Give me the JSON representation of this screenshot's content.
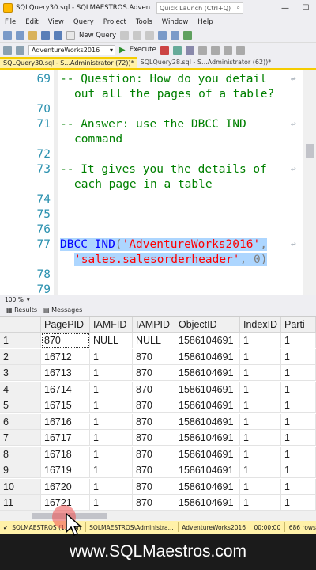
{
  "window": {
    "title": "SQLQuery30.sql - SQLMAESTROS.Adventure...",
    "quick_launch": "Quick Launch (Ctrl+Q)",
    "minimize": "—",
    "maximize": "☐",
    "close": "✕"
  },
  "menu": [
    "File",
    "Edit",
    "View",
    "Query",
    "Project",
    "Tools",
    "Window",
    "Help"
  ],
  "toolbar": {
    "new_query": "New Query",
    "database": "AdventureWorks2016",
    "execute": "Execute"
  },
  "tabs": [
    {
      "label": "SQLQuery30.sql - S...Administrator (72))*",
      "active": true
    },
    {
      "label": "SQLQuery28.sql - S...Administrator (62))*",
      "active": false
    }
  ],
  "editor": {
    "lines": [
      {
        "num": "69",
        "text": "-- Question: How do you detail",
        "type": "comment",
        "ret": true
      },
      {
        "num": "",
        "text": "out all the pages of a table?",
        "type": "comment-cont",
        "ret": false
      },
      {
        "num": "70",
        "text": "",
        "type": "blank",
        "ret": false
      },
      {
        "num": "71",
        "text": "-- Answer: use the DBCC IND",
        "type": "comment",
        "ret": true
      },
      {
        "num": "",
        "text": "command",
        "type": "comment-cont",
        "ret": false
      },
      {
        "num": "72",
        "text": "",
        "type": "blank",
        "ret": false
      },
      {
        "num": "73",
        "text": "-- It gives you the details of",
        "type": "comment",
        "ret": true
      },
      {
        "num": "",
        "text": "each page in a table",
        "type": "comment-cont",
        "ret": false
      },
      {
        "num": "74",
        "text": "",
        "type": "blank",
        "ret": false
      },
      {
        "num": "75",
        "text": "",
        "type": "blank",
        "ret": false
      },
      {
        "num": "76",
        "text": "",
        "type": "blank",
        "ret": false
      },
      {
        "num": "77",
        "text": "",
        "type": "code1",
        "ret": true
      },
      {
        "num": "",
        "text": "",
        "type": "code2",
        "ret": false
      },
      {
        "num": "78",
        "text": "",
        "type": "blank",
        "ret": false
      },
      {
        "num": "79",
        "text": "",
        "type": "blank",
        "ret": false
      }
    ],
    "code77": {
      "kw1": "DBCC",
      "kw2": "IND",
      "p1": "(",
      "s1": "'AdventureWorks2016'",
      "c1": ",",
      "s2": "'sales.salesorderheader'",
      "c2": ",",
      "n": "0",
      "p2": ")"
    }
  },
  "zoom": "100 %",
  "results_tabs": {
    "results": "Results",
    "messages": "Messages"
  },
  "grid": {
    "columns": [
      "",
      "PagePID",
      "IAMFID",
      "IAMPID",
      "ObjectID",
      "IndexID",
      "Parti"
    ],
    "rows": [
      [
        "1",
        "870",
        "NULL",
        "NULL",
        "1586104691",
        "1",
        "1"
      ],
      [
        "2",
        "16712",
        "1",
        "870",
        "1586104691",
        "1",
        "1"
      ],
      [
        "3",
        "16713",
        "1",
        "870",
        "1586104691",
        "1",
        "1"
      ],
      [
        "4",
        "16714",
        "1",
        "870",
        "1586104691",
        "1",
        "1"
      ],
      [
        "5",
        "16715",
        "1",
        "870",
        "1586104691",
        "1",
        "1"
      ],
      [
        "6",
        "16716",
        "1",
        "870",
        "1586104691",
        "1",
        "1"
      ],
      [
        "7",
        "16717",
        "1",
        "870",
        "1586104691",
        "1",
        "1"
      ],
      [
        "8",
        "16718",
        "1",
        "870",
        "1586104691",
        "1",
        "1"
      ],
      [
        "9",
        "16719",
        "1",
        "870",
        "1586104691",
        "1",
        "1"
      ],
      [
        "10",
        "16720",
        "1",
        "870",
        "1586104691",
        "1",
        "1"
      ],
      [
        "11",
        "16721",
        "1",
        "870",
        "1586104691",
        "1",
        "1"
      ],
      [
        "12",
        "16722",
        "1",
        "870",
        "1586104691",
        "1",
        "1"
      ]
    ]
  },
  "status": {
    "server": "SQLMAESTROS (1...FM)",
    "user": "SQLMAESTROS\\Administra...",
    "db": "AdventureWorks2016",
    "time": "00:00:00",
    "rows": "686 rows"
  },
  "footer": "www.SQLMaestros.com"
}
